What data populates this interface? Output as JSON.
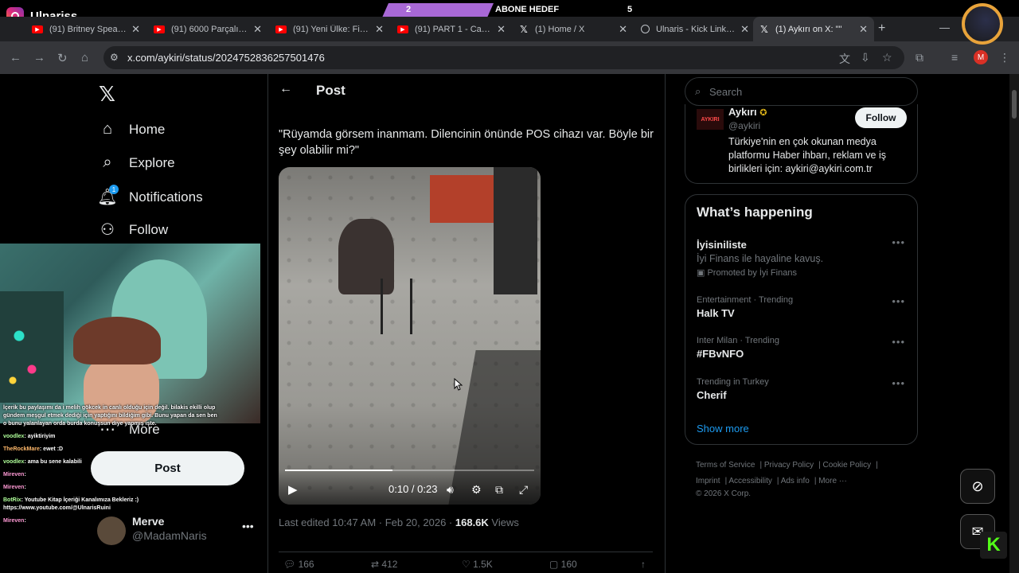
{
  "overlay": {
    "stream_title": "Ulnariss",
    "subgoal": {
      "count": "2",
      "label": "ABONE HEDEF",
      "target": "5"
    }
  },
  "browser": {
    "tabs": [
      {
        "title": "(91) Britney Spears - ",
        "icon": "youtube-icon"
      },
      {
        "title": "(91) 6000 Parçalık Pla",
        "icon": "youtube-icon"
      },
      {
        "title": "(91) Yeni Ülke: Finlan",
        "icon": "youtube-icon"
      },
      {
        "title": "(91) PART 1 - Canan",
        "icon": "youtube-icon"
      },
      {
        "title": "(1) Home / X",
        "icon": "x-icon"
      },
      {
        "title": "Ulnaris - Kick Link Vi",
        "icon": "kick-icon"
      },
      {
        "title": "(1) Aykırı on X: \"\"",
        "icon": "x-icon",
        "active": true
      }
    ],
    "url": "x.com/aykiri/status/2024752836257501476",
    "profile_initial": "M"
  },
  "x": {
    "nav": [
      {
        "label": "Home",
        "icon": "home-icon"
      },
      {
        "label": "Explore",
        "icon": "search-icon"
      },
      {
        "label": "Notifications",
        "icon": "bell-icon"
      },
      {
        "label": "Follow",
        "icon": "follow-icon"
      },
      {
        "label": "More",
        "icon": "more-icon"
      }
    ],
    "notif_badge": "1",
    "post_button": "Post",
    "profile": {
      "name": "Merve",
      "handle": "@MadamNaris"
    },
    "post_header": "Post",
    "tweet_text": "\"Rüyamda görsem inanmam. Dilencinin önünde POS cihazı var. Böyle bir şey olabilir mi?\"",
    "video": {
      "time": "0:10 / 0:23",
      "progress": 0.43
    },
    "meta": {
      "edited": "Last edited 10:47 AM · Feb 20, 2026 · ",
      "views": "168.6K",
      "views_label": " Views"
    },
    "actions": [
      "166",
      "412",
      "1.5K",
      "160"
    ],
    "search_placeholder": "Search",
    "who": {
      "logo": "AYKIRI",
      "name": "Aykırı",
      "handle": "@aykiri",
      "bio": "Türkiye'nin en çok okunan medya platformu Haber ihbarı, reklam ve iş birlikleri için: aykiri@aykiri.com.tr",
      "follow": "Follow"
    },
    "happening": {
      "title": "What’s happening",
      "trends": [
        {
          "context": "",
          "title": "İyisiniliste",
          "sub": "İyi Finans ile hayaline kavuş.",
          "promo": "Promoted by İyi Finans"
        },
        {
          "context": "Entertainment · Trending",
          "title": "Halk TV"
        },
        {
          "context": "Inter Milan · Trending",
          "title": "#FBvNFO"
        },
        {
          "context": "Trending in Turkey",
          "title": "Cherif"
        }
      ],
      "show_more": "Show more"
    },
    "footer": [
      "Terms of Service",
      "Privacy Policy",
      "Cookie Policy",
      "Imprint",
      "Accessibility",
      "Ads info",
      "More ···",
      "© 2026 X Corp."
    ]
  },
  "chat": [
    {
      "user": "",
      "text": "İçerik bu paylaşımı da i melih gökcek in canlı olduğu için değil. bilakis ekilli olup gündem meşgul etmek dediği için yaptığını bildiğim gibi. Bunu yapan da sen ben o bunu yalanlayan orda burda konuşsun diye yapmış işte."
    },
    {
      "user": "voodlex",
      "text": ": ayiktiriyim"
    },
    {
      "user": "TheRockMare",
      "text": ": ewet :D"
    },
    {
      "user": "voodlex",
      "text": ": ama bu sene kalabili"
    },
    {
      "user": "Mireven",
      "text": ": "
    },
    {
      "user": "Mireven",
      "text": ": "
    },
    {
      "user": "BotRix",
      "text": ": Youtube Kitap İçeriği Kanalımıza Bekleriz :) https://www.youtube.com/@UlnarisRuini"
    },
    {
      "user": "Mireven",
      "text": ": "
    }
  ],
  "colors": {
    "accent": "#1d9bf0",
    "kick": "#53fc18",
    "subgoal": "#a868d6"
  }
}
